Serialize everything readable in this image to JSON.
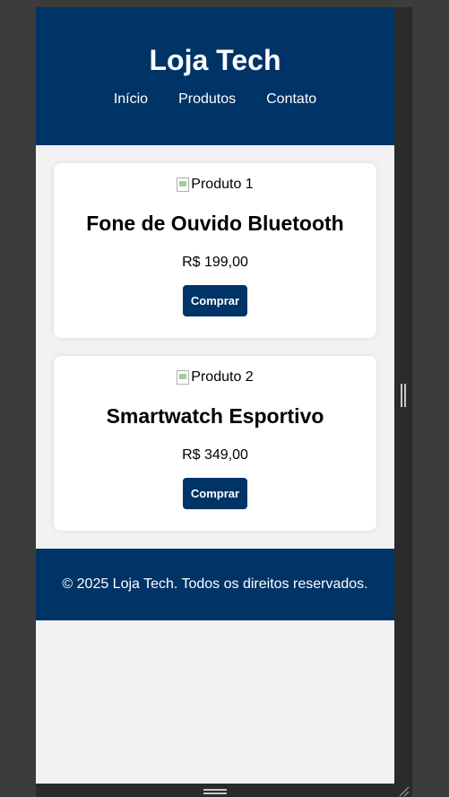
{
  "header": {
    "title": "Loja Tech",
    "nav": [
      {
        "label": "Início"
      },
      {
        "label": "Produtos"
      },
      {
        "label": "Contato"
      }
    ]
  },
  "products": [
    {
      "image_alt": "Produto 1",
      "name": "Fone de Ouvido Bluetooth",
      "price": "R$ 199,00",
      "button_label": "Comprar"
    },
    {
      "image_alt": "Produto 2",
      "name": "Smartwatch Esportivo",
      "price": "R$ 349,00",
      "button_label": "Comprar"
    }
  ],
  "footer": {
    "text": "© 2025 Loja Tech. Todos os direitos reservados."
  },
  "colors": {
    "brand": "#003366",
    "page_background": "#f2f2f2",
    "card_background": "#ffffff"
  }
}
